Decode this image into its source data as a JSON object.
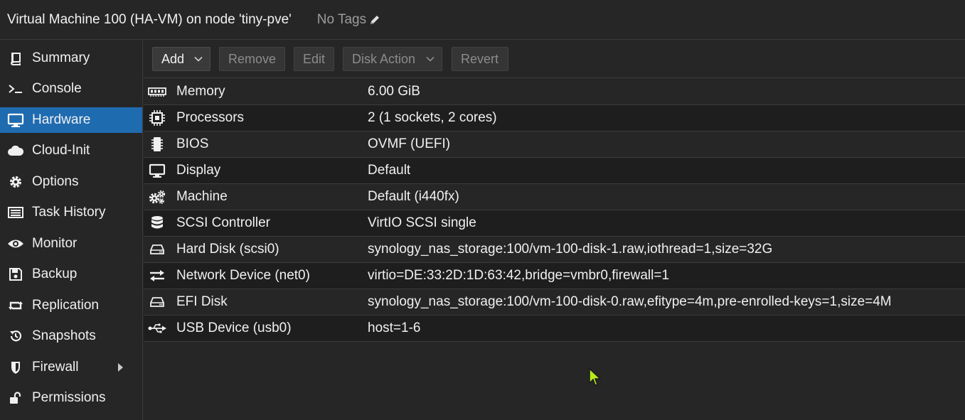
{
  "header": {
    "title": "Virtual Machine 100 (HA-VM) on node 'tiny-pve'",
    "tags_label": "No Tags",
    "edit_icon": "pencil-icon"
  },
  "sidebar": {
    "items": [
      {
        "label": "Summary",
        "icon": "book-icon",
        "active": false
      },
      {
        "label": "Console",
        "icon": "terminal-icon",
        "active": false
      },
      {
        "label": "Hardware",
        "icon": "monitor-icon",
        "active": true
      },
      {
        "label": "Cloud-Init",
        "icon": "cloud-icon",
        "active": false
      },
      {
        "label": "Options",
        "icon": "gear-icon",
        "active": false
      },
      {
        "label": "Task History",
        "icon": "list-icon",
        "active": false
      },
      {
        "label": "Monitor",
        "icon": "eye-icon",
        "active": false
      },
      {
        "label": "Backup",
        "icon": "floppy-icon",
        "active": false
      },
      {
        "label": "Replication",
        "icon": "retweet-icon",
        "active": false
      },
      {
        "label": "Snapshots",
        "icon": "history-icon",
        "active": false
      },
      {
        "label": "Firewall",
        "icon": "shield-icon",
        "active": false,
        "expandable": true
      },
      {
        "label": "Permissions",
        "icon": "unlock-icon",
        "active": false
      }
    ],
    "active_color": "#1f6bb0"
  },
  "toolbar": {
    "add_label": "Add",
    "remove_label": "Remove",
    "edit_label": "Edit",
    "disk_action_label": "Disk Action",
    "revert_label": "Revert"
  },
  "hardware": {
    "rows": [
      {
        "name": "Memory",
        "value": "6.00 GiB",
        "icon": "memory-icon"
      },
      {
        "name": "Processors",
        "value": "2 (1 sockets, 2 cores)",
        "icon": "cpu-icon"
      },
      {
        "name": "BIOS",
        "value": "OVMF (UEFI)",
        "icon": "microchip-icon"
      },
      {
        "name": "Display",
        "value": "Default",
        "icon": "desktop-icon"
      },
      {
        "name": "Machine",
        "value": "Default (i440fx)",
        "icon": "cogs-icon"
      },
      {
        "name": "SCSI Controller",
        "value": "VirtIO SCSI single",
        "icon": "database-icon"
      },
      {
        "name": "Hard Disk (scsi0)",
        "value": "synology_nas_storage:100/vm-100-disk-1.raw,iothread=1,size=32G",
        "icon": "hdd-icon"
      },
      {
        "name": "Network Device (net0)",
        "value": "virtio=DE:33:2D:1D:63:42,bridge=vmbr0,firewall=1",
        "icon": "exchange-icon"
      },
      {
        "name": "EFI Disk",
        "value": "synology_nas_storage:100/vm-100-disk-0.raw,efitype=4m,pre-enrolled-keys=1,size=4M",
        "icon": "hdd-icon"
      },
      {
        "name": "USB Device (usb0)",
        "value": "host=1-6",
        "icon": "usb-icon"
      }
    ]
  }
}
